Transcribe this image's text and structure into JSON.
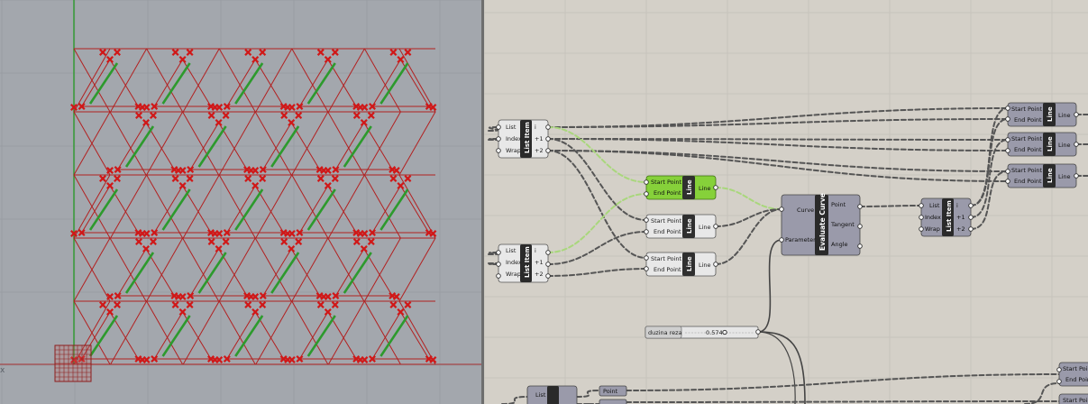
{
  "viewport": {
    "axis_label": "x"
  },
  "canvas": {
    "list_item_1": {
      "nick": "List Item",
      "inputs": [
        "List",
        "Index",
        "Wrap"
      ],
      "outputs": [
        "i",
        "+1",
        "+2"
      ]
    },
    "list_item_2": {
      "nick": "List Item",
      "inputs": [
        "List",
        "Index",
        "Wrap"
      ],
      "outputs": [
        "i",
        "+1",
        "+2"
      ]
    },
    "list_item_3": {
      "nick": "List Item",
      "inputs": [
        "List",
        "Index",
        "Wrap"
      ],
      "outputs": [
        "i",
        "+1",
        "+2"
      ]
    },
    "list_item_4": {
      "nick": "List Item",
      "inputs": [
        "List"
      ]
    },
    "line_green": {
      "nick": "Line",
      "inputs": [
        "Start Point",
        "End Point"
      ],
      "output": "Line"
    },
    "line_mid_1": {
      "nick": "Line",
      "inputs": [
        "Start Point",
        "End Point"
      ],
      "output": "Line"
    },
    "line_mid_2": {
      "nick": "Line",
      "inputs": [
        "Start Point",
        "End Point"
      ],
      "output": "Line"
    },
    "line_right_1": {
      "nick": "Line",
      "inputs": [
        "Start Point",
        "End Point"
      ],
      "output": "Line"
    },
    "line_right_2": {
      "nick": "Line",
      "inputs": [
        "Start Point",
        "End Point"
      ],
      "output": "Line"
    },
    "line_right_3": {
      "nick": "Line",
      "inputs": [
        "Start Point",
        "End Point"
      ],
      "output": "Line"
    },
    "line_right_4": {
      "nick": "Line",
      "inputs": [
        "Start Point",
        "End Point"
      ]
    },
    "evaluate_curve": {
      "nick": "Evaluate Curve",
      "inputs": [
        "Curve",
        "Parameter"
      ],
      "outputs": [
        "Point",
        "Tangent",
        "Angle"
      ]
    },
    "slider": {
      "label": "duzina reza",
      "value": "0.574"
    },
    "point_param_1": {
      "label": "Point"
    },
    "point_param_2": {
      "label": "Point"
    }
  }
}
